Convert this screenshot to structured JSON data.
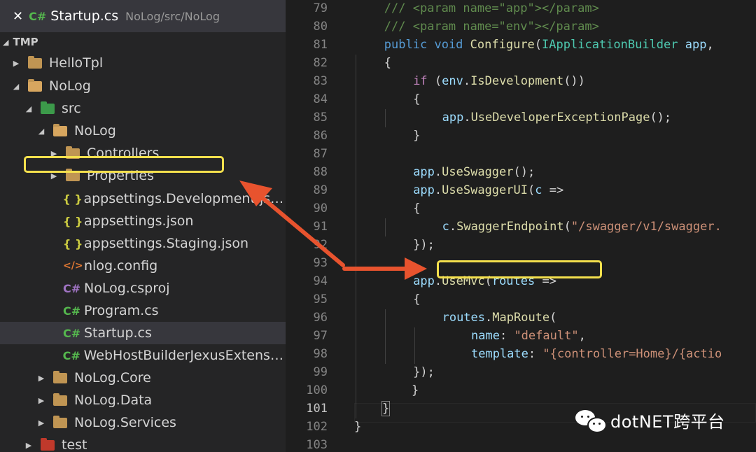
{
  "open_editor": {
    "close_glyph": "✕",
    "lang_glyph": "C#",
    "file": "Startup.cs",
    "path": "NoLog/src/NoLog"
  },
  "explorer": {
    "section": "TMP",
    "items": [
      {
        "label": "HelloTpl"
      },
      {
        "label": "NoLog"
      },
      {
        "label": "src"
      },
      {
        "label": "NoLog"
      },
      {
        "label": "Controllers"
      },
      {
        "label": "Properties"
      },
      {
        "label": "appsettings.Development.json",
        "icon": "{ }"
      },
      {
        "label": "appsettings.json",
        "icon": "{ }"
      },
      {
        "label": "appsettings.Staging.json",
        "icon": "{ }"
      },
      {
        "label": "nlog.config",
        "icon": "</>"
      },
      {
        "label": "NoLog.csproj",
        "icon": "C#"
      },
      {
        "label": "Program.cs",
        "icon": "C#"
      },
      {
        "label": "Startup.cs",
        "icon": "C#"
      },
      {
        "label": "WebHostBuilderJexusExtensi...",
        "icon": "C#"
      },
      {
        "label": "NoLog.Core"
      },
      {
        "label": "NoLog.Data"
      },
      {
        "label": "NoLog.Services"
      },
      {
        "label": "test"
      }
    ]
  },
  "editor": {
    "line_numbers": [
      "79",
      "80",
      "81",
      "82",
      "83",
      "84",
      "85",
      "86",
      "87",
      "88",
      "89",
      "90",
      "91",
      "92",
      "93",
      "94",
      "95",
      "96",
      "97",
      "98",
      "99",
      "100",
      "101",
      "102",
      "103"
    ],
    "current_line": "101",
    "lines": [
      [
        "/// <param name=\"app\"></param>"
      ],
      [
        "/// <param name=\"env\"></param>"
      ],
      [
        "public",
        " ",
        "void",
        " ",
        "Configure",
        "(",
        "IApplicationBuilder",
        " ",
        "app",
        ","
      ],
      [
        "{"
      ],
      [
        "if",
        " (",
        "env",
        ".",
        "IsDevelopment",
        "())"
      ],
      [
        "{"
      ],
      [
        "app",
        ".",
        "UseDeveloperExceptionPage",
        "();"
      ],
      [
        "}"
      ],
      [
        ""
      ],
      [
        "app",
        ".",
        "UseSwagger",
        "();"
      ],
      [
        "app",
        ".",
        "UseSwaggerUI",
        "(",
        "c",
        " =>"
      ],
      [
        "{"
      ],
      [
        "c",
        ".",
        "SwaggerEndpoint",
        "(",
        "\"/swagger/v1/swagger."
      ],
      [
        "});"
      ],
      [
        ""
      ],
      [
        "app",
        ".",
        "UseMvc",
        "(",
        "routes",
        " =>"
      ],
      [
        "{"
      ],
      [
        "routes",
        ".",
        "MapRoute",
        "("
      ],
      [
        "name",
        ": ",
        "\"default\"",
        ","
      ],
      [
        "template",
        ": ",
        "\"{controller=Home}/{actio"
      ],
      [
        "});"
      ],
      [
        "}"
      ],
      [
        "}"
      ],
      [
        "}"
      ],
      [
        ""
      ]
    ]
  },
  "watermark": {
    "text": "dotNET跨平台"
  },
  "colors": {
    "highlight_box": "#f4e04d",
    "arrow": "#e8532e"
  }
}
